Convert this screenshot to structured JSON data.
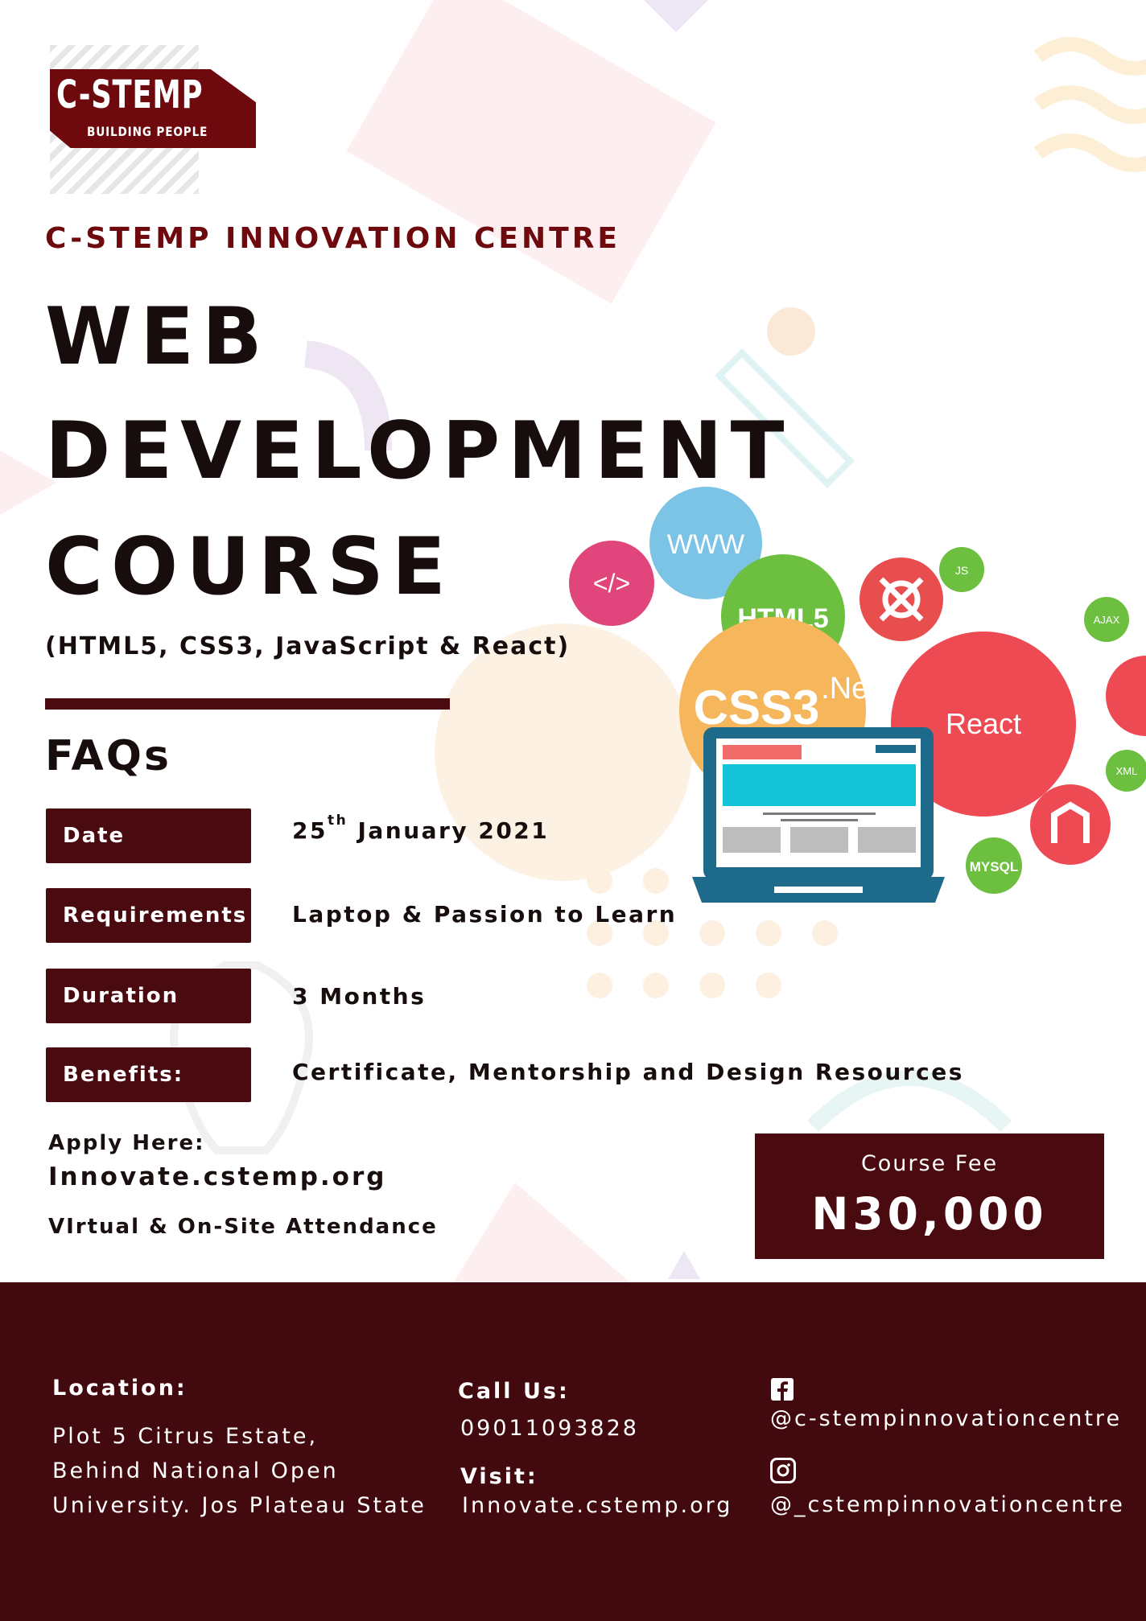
{
  "logo": {
    "name": "C-STEMP",
    "tagline": "BUILDING PEOPLE"
  },
  "org_name": "C-STEMP INNOVATION CENTRE",
  "title_lines": [
    "WEB",
    "DEVELOPMENT",
    "COURSE"
  ],
  "subtitle": "(HTML5, CSS3, JavaScript & React)",
  "faqs_heading": "FAQs",
  "faqs": [
    {
      "label": "Date",
      "value_pre": "25",
      "value_sup": "th",
      "value_post": " January 2021"
    },
    {
      "label": "Requirements",
      "value": "Laptop & Passion to Learn"
    },
    {
      "label": "Duration",
      "value": "3 Months"
    },
    {
      "label": "Benefits:",
      "value": "Certificate, Mentorship and Design Resources"
    }
  ],
  "apply": {
    "label": "Apply Here:",
    "url": "Innovate.cstemp.org",
    "attendance": "VIrtual & On-Site Attendance"
  },
  "fee": {
    "label": "Course Fee",
    "amount": "N30,000"
  },
  "tech_bubbles": [
    "</>",
    "WWW",
    "HTML5",
    "JS",
    "AJAX",
    "CSS3",
    ".Net",
    "React",
    "XML",
    "MYSQL"
  ],
  "footer": {
    "location_label": "Location:",
    "location_lines": [
      "Plot 5 Citrus Estate,",
      "Behind National Open",
      "University. Jos Plateau State"
    ],
    "call_label": "Call Us:",
    "phone": "09011093828",
    "visit_label": "Visit:",
    "visit_url": "Innovate.cstemp.org",
    "facebook_handle": "@c-stempinnovationcentre",
    "instagram_handle": "@_cstempinnovationcentre"
  },
  "colors": {
    "maroon": "#4a0b10",
    "brand_red": "#6e0a0e",
    "footer": "#420a0e"
  },
  "icons": [
    "facebook-icon",
    "instagram-icon",
    "laptop-illustration"
  ]
}
